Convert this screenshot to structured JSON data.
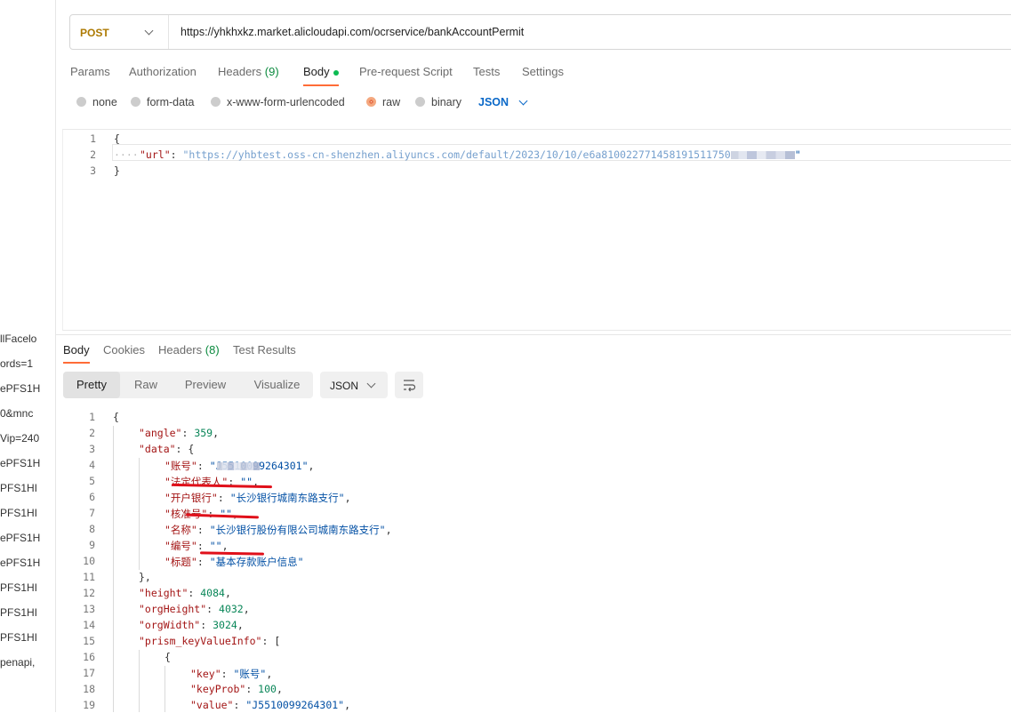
{
  "sidebar": {
    "items": [
      "llFacelo",
      "ords=1",
      "ePFS1H",
      "0&mnc",
      "Vip=240",
      "ePFS1H",
      "PFS1HI",
      "PFS1HI",
      "ePFS1H",
      "ePFS1H",
      "PFS1HI",
      "PFS1HI",
      "PFS1HI",
      "penapi,"
    ]
  },
  "request": {
    "method": "POST",
    "url": "https://yhkhxkz.market.alicloudapi.com/ocrservice/bankAccountPermit",
    "tabs": {
      "params": "Params",
      "authorization": "Authorization",
      "headers": "Headers",
      "headers_count": "(9)",
      "body": "Body",
      "prerequest": "Pre-request Script",
      "tests": "Tests",
      "settings": "Settings"
    },
    "body_types": {
      "none": "none",
      "form_data": "form-data",
      "urlencoded": "x-www-form-urlencoded",
      "raw": "raw",
      "binary": "binary",
      "format": "JSON"
    },
    "editor": {
      "line_numbers": [
        "1",
        "2",
        "3"
      ],
      "open": "{",
      "key": "\"url\"",
      "colon": ": ",
      "value_visible": "\"https://yhbtest.oss-cn-shenzhen.aliyuncs.com/default/2023/10/10/e6a810022771458191511750",
      "value_end": "\"",
      "close": "}"
    }
  },
  "response": {
    "tabs": {
      "body": "Body",
      "cookies": "Cookies",
      "headers": "Headers",
      "headers_count": "(8)",
      "test_results": "Test Results"
    },
    "views": {
      "pretty": "Pretty",
      "raw": "Raw",
      "preview": "Preview",
      "visualize": "Visualize",
      "format": "JSON"
    },
    "line_numbers": [
      "1",
      "2",
      "3",
      "4",
      "5",
      "6",
      "7",
      "8",
      "9",
      "10",
      "11",
      "12",
      "13",
      "14",
      "15",
      "16",
      "17",
      "18",
      "19"
    ],
    "lines": [
      {
        "k": "",
        "v": "{",
        "p": ""
      },
      {
        "k": "\"angle\"",
        "v": "359",
        "p": ","
      },
      {
        "k": "\"data\"",
        "v": "{",
        "p": ""
      },
      {
        "k": "\"账号\"",
        "v": "\"J5510099264301\"",
        "p": ","
      },
      {
        "k": "\"法定代表人\"",
        "v": "\"\"",
        "p": ","
      },
      {
        "k": "\"开户银行\"",
        "v": "\"长沙银行城南东路支行\"",
        "p": ","
      },
      {
        "k": "\"核准号\"",
        "v": "\"\"",
        "p": ","
      },
      {
        "k": "\"名称\"",
        "v": "\"长沙银行股份有限公司城南东路支行\"",
        "p": ","
      },
      {
        "k": "\"编号\"",
        "v": "\"\"",
        "p": ","
      },
      {
        "k": "\"标题\"",
        "v": "\"基本存款账户信息\"",
        "p": ""
      },
      {
        "k": "",
        "v": "},",
        "p": ""
      },
      {
        "k": "\"height\"",
        "v": "4084",
        "p": ","
      },
      {
        "k": "\"orgHeight\"",
        "v": "4032",
        "p": ","
      },
      {
        "k": "\"orgWidth\"",
        "v": "3024",
        "p": ","
      },
      {
        "k": "\"prism_keyValueInfo\"",
        "v": "[",
        "p": ""
      },
      {
        "k": "",
        "v": "{",
        "p": ""
      },
      {
        "k": "\"key\"",
        "v": "\"账号\"",
        "p": ","
      },
      {
        "k": "\"keyProb\"",
        "v": "100",
        "p": ","
      },
      {
        "k": "\"value\"",
        "v": "\"J5510099264301\"",
        "p": ","
      }
    ]
  }
}
